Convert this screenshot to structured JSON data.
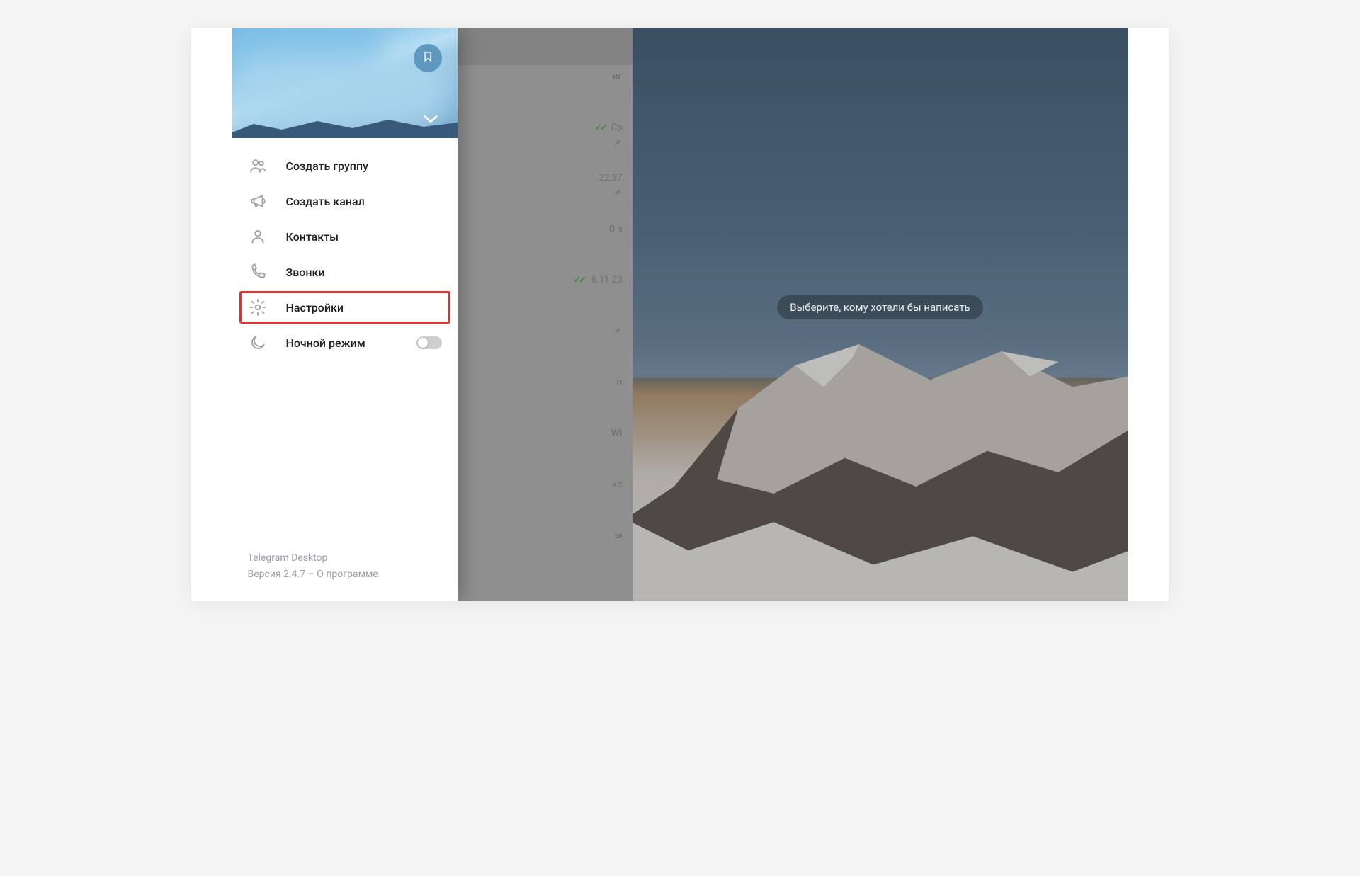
{
  "drawer": {
    "menu": [
      {
        "key": "new-group",
        "label": "Создать группу"
      },
      {
        "key": "new-channel",
        "label": "Создать канал"
      },
      {
        "key": "contacts",
        "label": "Контакты"
      },
      {
        "key": "calls",
        "label": "Звонки"
      },
      {
        "key": "settings",
        "label": "Настройки",
        "highlighted": true
      },
      {
        "key": "night-mode",
        "label": "Ночной режим",
        "toggle": false
      }
    ],
    "footer": {
      "app_name": "Telegram Desktop",
      "version_prefix": "Версия ",
      "version": "2.4.7",
      "separator": " – ",
      "about_label": "О программе"
    }
  },
  "chat_list": {
    "items": [
      {
        "fragment": "иг",
        "time": ""
      },
      {
        "fragment": "",
        "time": "Ср",
        "ticks": true,
        "pinned": true
      },
      {
        "fragment": ".)",
        "time": "22:37",
        "pinned": true
      },
      {
        "fragment": "0 з",
        "time": ""
      },
      {
        "fragment": "",
        "time": "6.11.20",
        "ticks": true,
        "pinned": true
      },
      {
        "fragment": "п",
        "time": ""
      },
      {
        "fragment": "Wi",
        "time": ""
      },
      {
        "fragment": "кс",
        "time": ""
      },
      {
        "fragment": "ы",
        "time": ""
      }
    ]
  },
  "main": {
    "placeholder": "Выберите, кому хотели бы написать"
  }
}
